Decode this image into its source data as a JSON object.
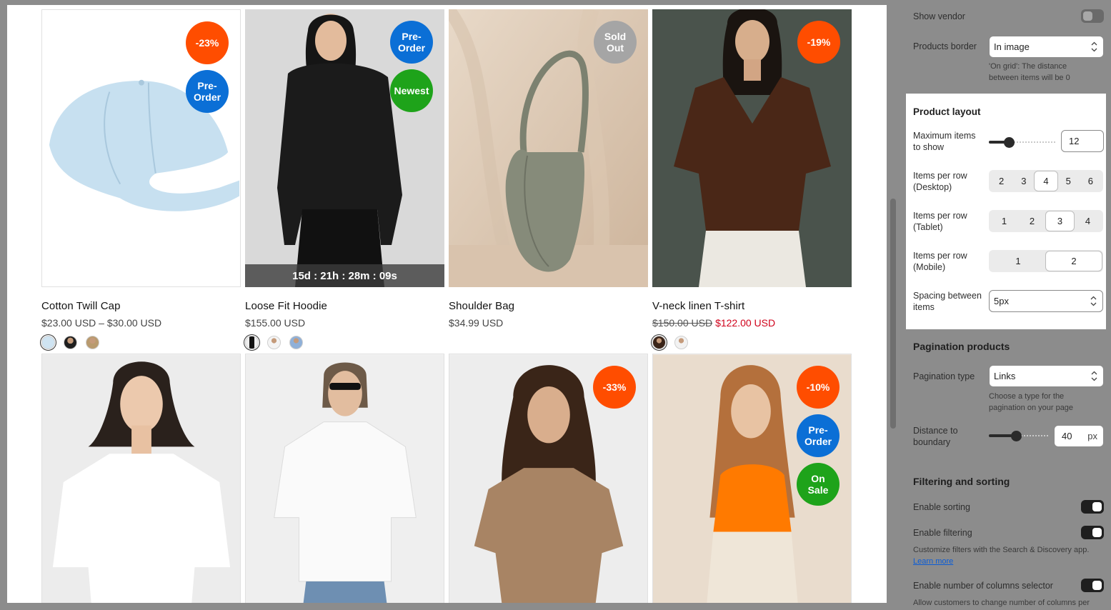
{
  "products": [
    {
      "name": "Cotton Twill Cap",
      "price": "$23.00 USD – $30.00 USD",
      "badges": [
        {
          "text": "-23%",
          "color": "orange"
        },
        {
          "text": "Pre-\nOrder",
          "color": "blue"
        }
      ],
      "swatches": 3
    },
    {
      "name": "Loose Fit Hoodie",
      "price": "$155.00 USD",
      "badges": [
        {
          "text": "Pre-\nOrder",
          "color": "blue"
        },
        {
          "text": "Newest",
          "color": "green"
        }
      ],
      "countdown": "15d : 21h : 28m : 09s",
      "swatches": 3
    },
    {
      "name": "Shoulder Bag",
      "price": "$34.99 USD",
      "badges": [
        {
          "text": "Sold\nOut",
          "color": "gray"
        }
      ],
      "swatches": 0
    },
    {
      "name": "V-neck linen T-shirt",
      "old_price": "$150.00 USD",
      "sale_price": "$122.00 USD",
      "badges": [
        {
          "text": "-19%",
          "color": "orange"
        }
      ],
      "swatches": 2
    },
    {
      "name": "",
      "badges": []
    },
    {
      "name": "",
      "badges": []
    },
    {
      "name": "",
      "badges": [
        {
          "text": "-33%",
          "color": "orange"
        }
      ]
    },
    {
      "name": "",
      "badges": [
        {
          "text": "-10%",
          "color": "orange"
        },
        {
          "text": "Pre-\nOrder",
          "color": "blue"
        },
        {
          "text": "On\nSale",
          "color": "green"
        }
      ]
    }
  ],
  "settings": {
    "show_vendor": {
      "label": "Show vendor",
      "on": false
    },
    "products_border": {
      "label": "Products border",
      "value": "In image",
      "help": "'On grid': The distance between items will be 0"
    },
    "product_layout": {
      "title": "Product layout",
      "max_items": {
        "label": "Maximum items to show",
        "value": "12",
        "slider_fraction": 0.25
      },
      "desktop": {
        "label": "Items per row (Desktop)",
        "options": [
          "2",
          "3",
          "4",
          "5",
          "6"
        ],
        "selected": "4"
      },
      "tablet": {
        "label": "Items per row (Tablet)",
        "options": [
          "1",
          "2",
          "3",
          "4"
        ],
        "selected": "3"
      },
      "mobile": {
        "label": "Items per row (Mobile)",
        "options": [
          "1",
          "2"
        ],
        "selected": "2"
      },
      "spacing": {
        "label": "Spacing between items",
        "value": "5px"
      }
    },
    "pagination": {
      "title": "Pagination products",
      "type": {
        "label": "Pagination type",
        "value": "Links",
        "help": "Choose a type for the pagination on your page"
      },
      "distance": {
        "label": "Distance to boundary",
        "value": "40",
        "unit": "px",
        "slider_fraction": 0.4
      }
    },
    "filtering": {
      "title": "Filtering and sorting",
      "sorting": {
        "label": "Enable sorting",
        "on": true
      },
      "filtering": {
        "label": "Enable filtering",
        "on": true,
        "help": "Customize filters with the Search & Discovery app.",
        "link": "Learn more"
      },
      "columns": {
        "label": "Enable number of columns selector",
        "on": true,
        "help": "Allow customers to change number of columns per"
      }
    }
  },
  "colors": {
    "orange": "#ff4d00",
    "blue": "#0b6fd6",
    "green": "#1ea31a",
    "gray": "#a5a5a5",
    "sale_red": "#d0021b"
  }
}
